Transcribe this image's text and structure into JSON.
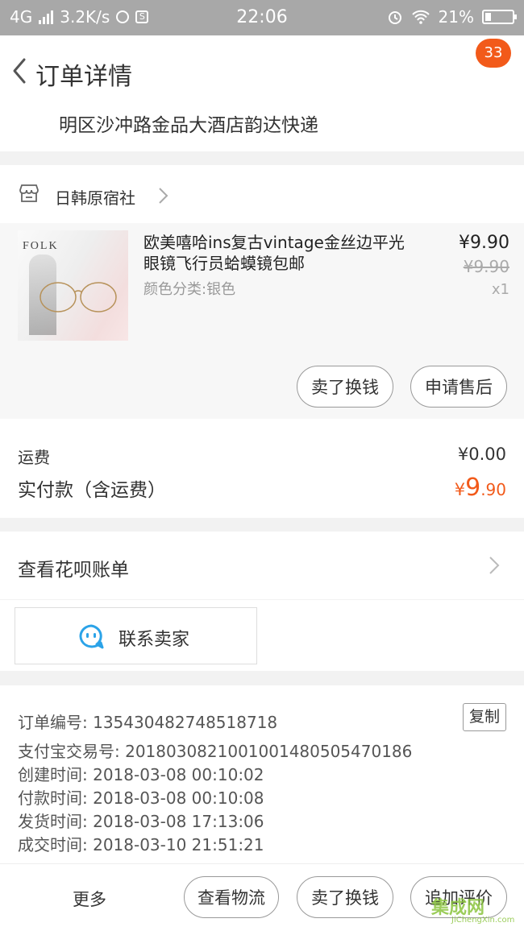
{
  "status_bar": {
    "network": "4G",
    "speed": "3.2K/s",
    "time": "22:06",
    "battery": "21%",
    "battery_level": 0.21
  },
  "nav": {
    "title": "订单详情",
    "badge": "33"
  },
  "address": {
    "line2": "明区沙冲路金品大酒店韵达快递"
  },
  "store": {
    "name": "日韩原宿社"
  },
  "product": {
    "title": "欧美嘻哈ins复古vintage金丝边平光眼镜飞行员蛤蟆镜包邮",
    "variant": "颜色分类:银色",
    "price": "¥9.90",
    "original_price": "¥9.90",
    "quantity": "x1",
    "image_text": "FOLK",
    "actions": [
      "卖了换钱",
      "申请售后"
    ]
  },
  "totals": {
    "shipping_label": "运费",
    "shipping_value": "¥0.00",
    "paid_label": "实付款（含运费）",
    "paid_currency": "¥",
    "paid_int": "9",
    "paid_dec": ".90"
  },
  "huabei": {
    "label": "查看花呗账单"
  },
  "contact": {
    "label": "联系卖家"
  },
  "order_info": {
    "rows": [
      "订单编号: 135430482748518718",
      "支付宝交易号: 2018030821001001480505470186",
      "创建时间: 2018-03-08 00:10:02",
      "付款时间: 2018-03-08 00:10:08",
      "发货时间: 2018-03-08 17:13:06",
      "成交时间: 2018-03-10 21:51:21"
    ],
    "copy_label": "复制"
  },
  "footer": {
    "more": "更多",
    "buttons": [
      "查看物流",
      "卖了换钱",
      "追加评价"
    ],
    "watermark": "集成网",
    "watermark_url": "JiChengXin.com"
  },
  "colors": {
    "accent": "#f25a1a",
    "contact_icon": "#2ba3e8"
  }
}
